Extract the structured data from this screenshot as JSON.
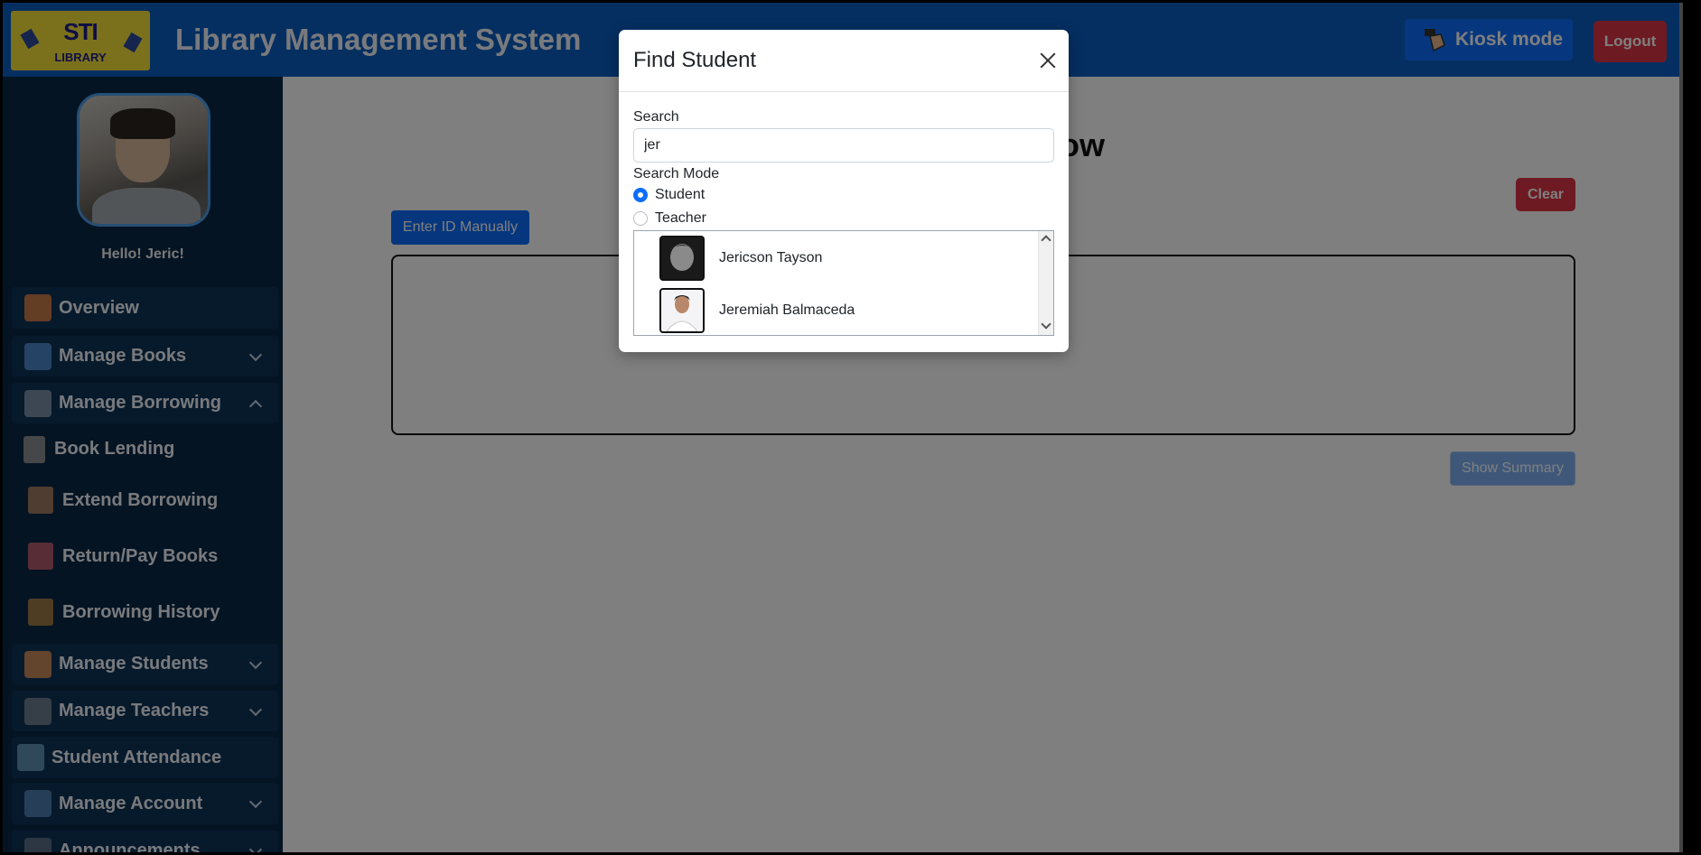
{
  "header": {
    "app_title": "Library Management System",
    "logo_text_top": "STI",
    "logo_text_bottom": "LIBRARY",
    "kiosk_label": "Kiosk mode",
    "logout_label": "Logout"
  },
  "sidebar": {
    "greeting": "Hello! Jeric!",
    "items": [
      {
        "label": "Overview",
        "icon": "overview-icon"
      },
      {
        "label": "Manage Books",
        "icon": "books-icon"
      },
      {
        "label": "Manage Borrowing",
        "icon": "borrowing-icon"
      },
      {
        "label": "Book Lending",
        "icon": "lending-icon"
      },
      {
        "label": "Extend Borrowing",
        "icon": "extend-icon"
      },
      {
        "label": "Return/Pay Books",
        "icon": "return-icon"
      },
      {
        "label": "Borrowing History",
        "icon": "history-icon"
      },
      {
        "label": "Manage Students",
        "icon": "students-icon"
      },
      {
        "label": "Manage Teachers",
        "icon": "teachers-icon"
      },
      {
        "label": "Student Attendance",
        "icon": "attendance-icon"
      },
      {
        "label": "Manage Account",
        "icon": "account-icon"
      },
      {
        "label": "Announcements",
        "icon": "announcements-icon"
      }
    ]
  },
  "main": {
    "title_partial": "ow",
    "enter_id_label": "Enter ID Manually",
    "clear_label": "Clear",
    "summary_label": "Show Summary"
  },
  "modal": {
    "title": "Find Student",
    "search_label": "Search",
    "search_value": "jer",
    "mode_label": "Search Mode",
    "modes": [
      {
        "label": "Student",
        "selected": true
      },
      {
        "label": "Teacher",
        "selected": false
      }
    ],
    "results": [
      {
        "name": "Jericson Tayson"
      },
      {
        "name": "Jeremiah Balmaceda"
      }
    ]
  },
  "colors": {
    "header": "#0a5fc2",
    "sidebar": "#0a2847",
    "primary": "#0d6efd",
    "danger": "#dc3545"
  }
}
